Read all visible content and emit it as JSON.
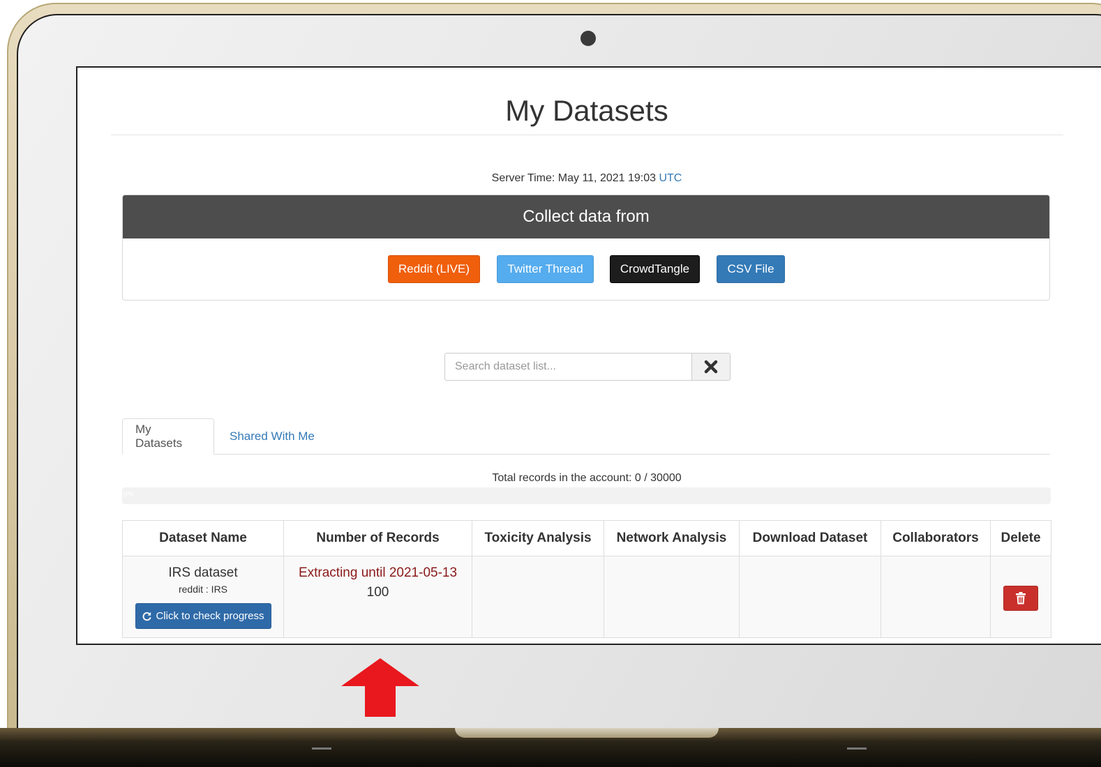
{
  "page": {
    "title": "My Datasets",
    "server_time_label": "Server Time: May 11, 2021 19:03 ",
    "server_time_zone": "UTC"
  },
  "collect": {
    "header": "Collect data from",
    "buttons": [
      {
        "label": "Reddit (LIVE)",
        "color": "#f05f0c"
      },
      {
        "label": "Twitter Thread",
        "color": "#55acee"
      },
      {
        "label": "CrowdTangle",
        "color": "#1d1d1d"
      },
      {
        "label": "CSV File",
        "color": "#337ab7"
      }
    ]
  },
  "search": {
    "placeholder": "Search dataset list...",
    "value": "",
    "clear_icon": "close-icon"
  },
  "tabs": [
    {
      "label": "My Datasets",
      "active": true
    },
    {
      "label": "Shared With Me",
      "active": false
    }
  ],
  "records": {
    "summary": "Total records in the account: 0 / 30000",
    "progress_percent": 0,
    "progress_label": "0%"
  },
  "table": {
    "columns": [
      "Dataset Name",
      "Number of Records",
      "Toxicity Analysis",
      "Network Analysis",
      "Download Dataset",
      "Collaborators",
      "Delete"
    ],
    "rows": [
      {
        "name": "IRS dataset",
        "source": "reddit : IRS",
        "progress_button": "Click to check progress",
        "status": "Extracting until 2021-05-13",
        "count": "100",
        "toxicity": "",
        "network": "",
        "download": "",
        "collaborators": ""
      }
    ]
  },
  "colors": {
    "accent": "#337ab7",
    "delete": "#c9302c",
    "status_text": "#8b1a1a",
    "annotation_arrow": "#e8181e"
  }
}
